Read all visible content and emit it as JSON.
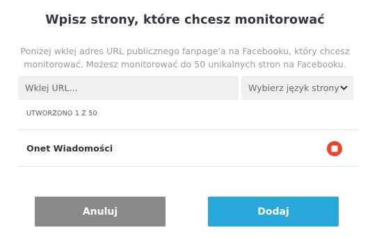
{
  "dialog": {
    "title": "Wpisz strony, które chcesz monitorować",
    "description": "Poniżej wklej adres URL publicznego fanpage'a na Facebooku, który chcesz monitorować. Możesz monitorować do 50 unikalnych stron na Facebooku."
  },
  "form": {
    "url_placeholder": "Wklej URL...",
    "url_value": "",
    "language_select_label": "Wybierz język strony",
    "language_icon": "chevron-down-icon"
  },
  "pages": {
    "created_label": "UTWORZONO 1 Z 50",
    "items": [
      {
        "name": "Onet Wiadomości",
        "remove_icon": "stop-icon"
      }
    ]
  },
  "actions": {
    "cancel_label": "Anuluj",
    "add_label": "Dodaj"
  },
  "colors": {
    "title": "#333740",
    "muted_text": "#9a9a9a",
    "input_bg": "#efefef",
    "delete_red": "#e8452c",
    "cancel_gray": "#898989",
    "add_blue": "#27a8d8"
  }
}
